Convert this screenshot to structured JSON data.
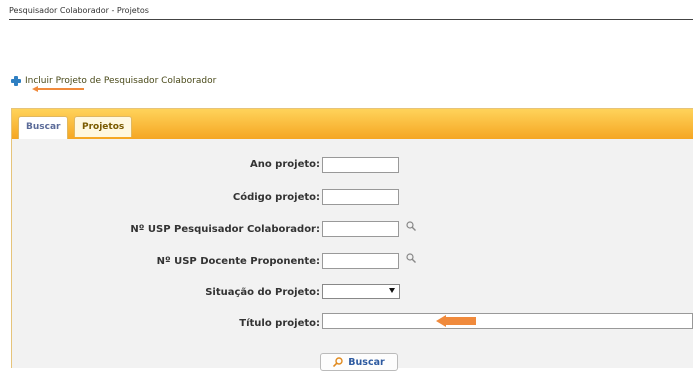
{
  "header": {
    "title": "Pesquisador Colaborador - Projetos"
  },
  "actions": {
    "include_link": "Incluir Projeto de Pesquisador Colaborador"
  },
  "tabs": [
    {
      "label": "Buscar",
      "active": true
    },
    {
      "label": "Projetos",
      "active": false
    }
  ],
  "form": {
    "ano_label": "Ano projeto:",
    "codigo_label": "Código projeto:",
    "nusp_colab_label": "Nº USP Pesquisador Colaborador:",
    "nusp_docente_label": "Nº USP Docente Proponente:",
    "situacao_label": "Situação do Projeto:",
    "titulo_label": "Título projeto:",
    "situacao_selected": "",
    "submit_label": "Buscar"
  },
  "colors": {
    "tab_bar": "#f5a623",
    "panel_bg": "#f2f2f2",
    "plus_icon": "#2f7fc2",
    "annotation_arrow": "#f08a3c"
  }
}
